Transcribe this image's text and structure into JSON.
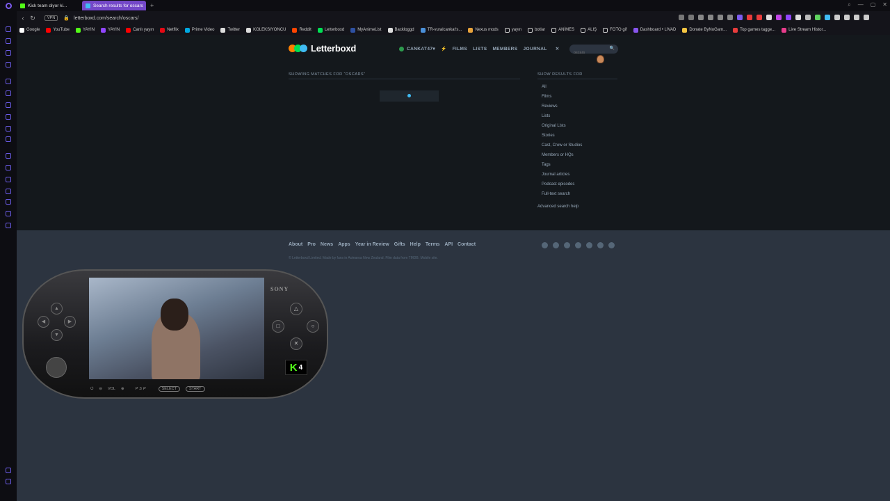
{
  "browser": {
    "tabs": [
      {
        "title": "Kick team diyor ki...",
        "active": false,
        "color": "#53fc18"
      },
      {
        "title": "Search results for oscars",
        "active": true,
        "color": "#40bcf4"
      }
    ],
    "new_tab": "+",
    "vpn": "VPN",
    "url": "letterboxd.com/search/oscars/",
    "bookmarks": [
      {
        "label": "Google",
        "color": "#ffffff"
      },
      {
        "label": "YouTube",
        "color": "#ff0000"
      },
      {
        "label": "YAYIN",
        "color": "#53fc18"
      },
      {
        "label": "YAYIN",
        "color": "#9146ff"
      },
      {
        "label": "Canlı yayın",
        "color": "#ff0000"
      },
      {
        "label": "Netflix",
        "color": "#e50914"
      },
      {
        "label": "Prime Video",
        "color": "#00a8e1"
      },
      {
        "label": "Twitter",
        "color": "#dddddd"
      },
      {
        "label": "KOLEKSIYONCU",
        "color": "#dddddd"
      },
      {
        "label": "Reddit",
        "color": "#ff4500"
      },
      {
        "label": "Letterboxd",
        "color": "#00e054"
      },
      {
        "label": "MyAnimeList",
        "color": "#2e51a2"
      },
      {
        "label": "Backloggd",
        "color": "#dddddd"
      },
      {
        "label": "TR-vuralcankat's...",
        "color": "#4a90d9"
      },
      {
        "label": "Nexus mods",
        "color": "#e8a33c"
      },
      {
        "label": "yayın",
        "color": "#cccccc"
      },
      {
        "label": "botlar",
        "color": "#cccccc"
      },
      {
        "label": "ANİMES",
        "color": "#cccccc"
      },
      {
        "label": "ALIŞ",
        "color": "#cccccc"
      },
      {
        "label": "FOTO gif",
        "color": "#cccccc"
      },
      {
        "label": "Dashboard • LIVAD",
        "color": "#8855ee"
      },
      {
        "label": "Donate ByNoGam...",
        "color": "#f5c542"
      },
      {
        "label": "Top games tagge...",
        "color": "#e83c3c"
      },
      {
        "label": "Live Stream Histor...",
        "color": "#e83c8c"
      }
    ]
  },
  "site": {
    "name": "Letterboxd",
    "logo_colors": [
      "#ff8000",
      "#00e054",
      "#40bcf4"
    ],
    "nav": {
      "username": "CANKAT47",
      "films": "FILMS",
      "lists": "LISTS",
      "members": "MEMBERS",
      "journal": "JOURNAL"
    },
    "search_placeholder": "oscars"
  },
  "results": {
    "heading": "SHOWING MATCHES FOR “OSCARS”"
  },
  "filters": {
    "title": "SHOW RESULTS FOR",
    "items": [
      "All",
      "Films",
      "Reviews",
      "Lists",
      "Original Lists",
      "Stories",
      "Cast, Crew or Studios",
      "Members or HQs",
      "Tags",
      "Journal articles",
      "Podcast episodes",
      "Full-text search"
    ],
    "advanced": "Advanced search help"
  },
  "footer": {
    "links": [
      "About",
      "Pro",
      "News",
      "Apps",
      "Year in Review",
      "Gifts",
      "Help",
      "Terms",
      "API",
      "Contact"
    ],
    "copyright": "© Letterboxd Limited. Made by fans in Aotearoa New Zealand. Film data from TMDB. Mobile site."
  },
  "overlay": {
    "brand": "SONY",
    "console": "PSP",
    "vol": "VOL",
    "select": "SELECT",
    "start": "START",
    "kick_logo": "K",
    "kick_count": "4"
  }
}
